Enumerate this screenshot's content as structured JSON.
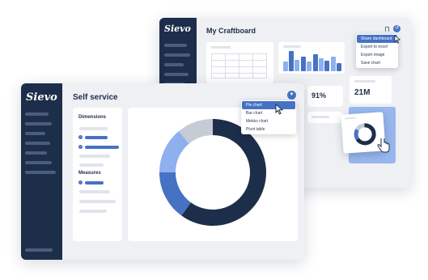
{
  "back_window": {
    "logo": "Sievo",
    "title": "My Craftboard",
    "kpi_percent": "91%",
    "kpi_amount": "21M",
    "menu_items": [
      "Share dashboard",
      "Export to excel",
      "Export image",
      "Save chart"
    ],
    "menu_selected_index": 0,
    "bar_chart_values": [
      0.45,
      0.95,
      0.55,
      0.7,
      0.45,
      0.8,
      0.6,
      0.5,
      0.7,
      0.4
    ],
    "bar_colors": [
      "#8eb0ee",
      "#4672c4"
    ]
  },
  "front_window": {
    "logo": "Sievo",
    "title": "Self service",
    "dimensions_label": "Dimensions",
    "measures_label": "Measures",
    "chart_type_menu": [
      "Pie chart",
      "Bar chart",
      "Mekko chart",
      "Pivot table"
    ],
    "chart_type_selected_index": 0
  },
  "chart_data": {
    "type": "pie",
    "labels": [],
    "values": [
      60,
      15,
      14,
      11
    ],
    "colors": [
      "#1d2e4b",
      "#4672c4",
      "#8eb0ee",
      "#c5ccd6"
    ],
    "donut": true
  },
  "colors": {
    "navy": "#1d2e4b",
    "accent": "#4672c4",
    "light_blue": "#8eb0ee",
    "grey": "#c5ccd6"
  },
  "icons": [
    "chevron-down-icon",
    "share-icon",
    "cursor-icon",
    "bookmark-icon"
  ]
}
